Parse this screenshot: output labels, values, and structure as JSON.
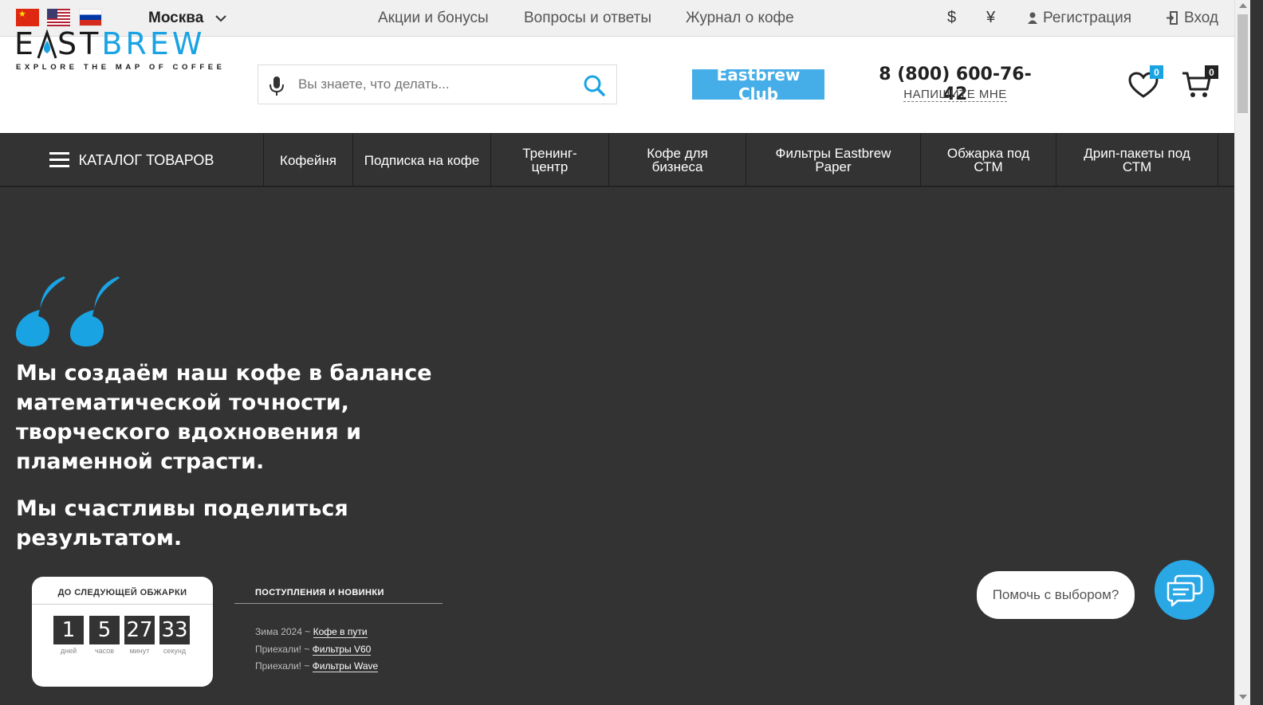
{
  "topbar": {
    "flags": [
      "china-flag",
      "usa-flag",
      "russia-flag"
    ],
    "city": "Москва",
    "links": [
      "Акции и бонусы",
      "Вопросы и ответы",
      "Журнал о кофе"
    ],
    "currencies": [
      "$",
      "¥"
    ],
    "register": "Регистрация",
    "login": "Вход"
  },
  "header": {
    "logo_prefix": "E",
    "logo_mid": "ST",
    "logo_suffix": "BREW",
    "logo_tagline": "EXPLORE THE MAP OF COFFEE",
    "search_placeholder": "Вы знаете, что делать...",
    "club_button": "Eastbrew Club",
    "phone": "8 (800) 600-76-42",
    "write_me": "НАПИШИТЕ МНЕ",
    "favorites_count": "0",
    "cart_count": "0"
  },
  "nav": {
    "catalog": "КАТАЛОГ ТОВАРОВ",
    "items": [
      "Кофейня",
      "Подписка на кофе",
      "Тренинг-центр",
      "Кофе для бизнеса",
      "Фильтры Eastbrew Paper",
      "Обжарка под СТМ",
      "Дрип-пакеты под СТМ"
    ]
  },
  "hero": {
    "line1": "Мы создаём наш кофе в балансе математической точности, творческого вдохновения и пламенной страсти.",
    "line2": "Мы счастливы поделиться результатом."
  },
  "countdown": {
    "title": "ДО СЛЕДУЮЩЕЙ ОБЖАРКИ",
    "days": "1",
    "days_label": "дней",
    "hours": "5",
    "hours_label": "часов",
    "minutes": "27",
    "minutes_label": "минут",
    "seconds": "33",
    "seconds_label": "секунд"
  },
  "news": {
    "title": "ПОСТУПЛЕНИЯ И НОВИНКИ",
    "items": [
      {
        "prefix": "Зима 2024 ~ ",
        "link": "Кофе в пути"
      },
      {
        "prefix": "Приехали! ~ ",
        "link": "Фильтры V60"
      },
      {
        "prefix": "Приехали! ~ ",
        "link": "Фильтры Wave"
      }
    ]
  },
  "chat": {
    "prompt": "Помочь с выбором?"
  },
  "colors": {
    "accent": "#1aa3e3",
    "club_button": "#45aee8",
    "dark_bg": "#333333",
    "chat_button": "#2aa8e6"
  }
}
